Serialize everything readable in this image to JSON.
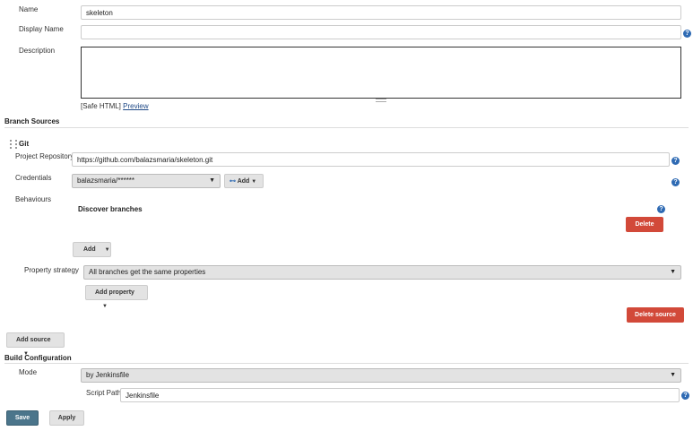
{
  "general": {
    "name_label": "Name",
    "name_value": "skeleton",
    "display_name_label": "Display Name",
    "display_name_value": "",
    "description_label": "Description",
    "description_value": "",
    "safe_html": "[Safe HTML]",
    "preview_link": "Preview"
  },
  "branch_sources": {
    "section_title": "Branch Sources",
    "git": {
      "title": "Git",
      "project_repository_label": "Project Repository",
      "project_repository_value": "https://github.com/balazsmaria/skeleton.git",
      "credentials_label": "Credentials",
      "credentials_value": "balazsmaria/******",
      "credentials_add_label": "Add",
      "behaviours_label": "Behaviours",
      "discover_branches_title": "Discover branches",
      "delete_label": "Delete",
      "add_label": "Add",
      "property_strategy_label": "Property strategy",
      "property_strategy_value": "All branches get the same properties",
      "add_property_label": "Add property",
      "delete_source_label": "Delete source"
    },
    "add_source_label": "Add source"
  },
  "build_configuration": {
    "section_title": "Build Configuration",
    "mode_label": "Mode",
    "mode_value": "by Jenkinsfile",
    "script_path_label": "Script Path",
    "script_path_value": "Jenkinsfile"
  },
  "actions": {
    "save_label": "Save",
    "apply_label": "Apply"
  },
  "icons": {
    "help": "?",
    "caret": "▼",
    "key_icon": "⊷"
  },
  "colors": {
    "delete_red": "#d24939",
    "save_blue": "#4b758b",
    "help_blue": "#2e6ab3"
  }
}
